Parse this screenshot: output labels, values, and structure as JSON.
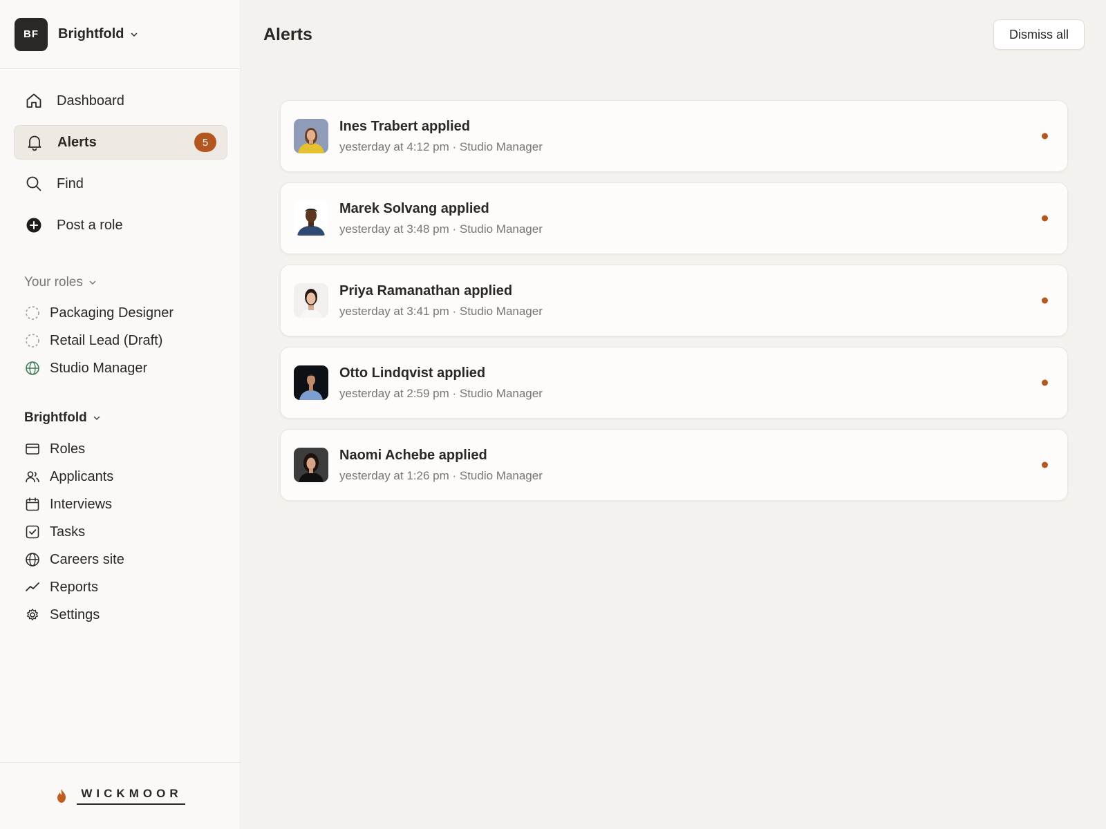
{
  "org": {
    "initials": "BF",
    "name": "Brightfold"
  },
  "nav": {
    "items": [
      {
        "label": "Dashboard",
        "icon": "home-icon"
      },
      {
        "label": "Alerts",
        "icon": "bell-icon",
        "badge": "5"
      },
      {
        "label": "Find",
        "icon": "search-icon"
      },
      {
        "label": "Post a role",
        "icon": "plus-circle-icon"
      }
    ]
  },
  "roles": {
    "title": "Your roles",
    "items": [
      {
        "label": "Packaging Designer",
        "icon": "dashed-circle-icon"
      },
      {
        "label": "Retail Lead (Draft)",
        "icon": "dashed-circle-icon"
      },
      {
        "label": "Studio Manager",
        "icon": "globe-icon"
      }
    ]
  },
  "company": {
    "title": "Brightfold",
    "items": [
      {
        "label": "Roles",
        "icon": "card-icon"
      },
      {
        "label": "Applicants",
        "icon": "users-icon"
      },
      {
        "label": "Interviews",
        "icon": "calendar-icon"
      },
      {
        "label": "Tasks",
        "icon": "checkbox-icon"
      },
      {
        "label": "Careers site",
        "icon": "globe-icon"
      },
      {
        "label": "Reports",
        "icon": "trend-line-icon"
      },
      {
        "label": "Settings",
        "icon": "gear-icon"
      }
    ]
  },
  "footer": {
    "brand": "WICKMOOR"
  },
  "main": {
    "title": "Alerts",
    "dismiss_label": "Dismiss all",
    "alerts": [
      {
        "title": "Ines Trabert applied",
        "subtitle": "yesterday at 4:12 pm · Studio Manager"
      },
      {
        "title": "Marek Solvang applied",
        "subtitle": "yesterday at 3:48 pm · Studio Manager"
      },
      {
        "title": "Priya Ramanathan applied",
        "subtitle": "yesterday at 3:41 pm · Studio Manager"
      },
      {
        "title": "Otto Lindqvist applied",
        "subtitle": "yesterday at 2:59 pm · Studio Manager"
      },
      {
        "title": "Naomi Achebe applied",
        "subtitle": "yesterday at 1:26 pm · Studio Manager"
      }
    ]
  },
  "colors": {
    "accent": "#b4561f",
    "background": "#f4f2ee",
    "sidebar": "#faf9f7"
  }
}
